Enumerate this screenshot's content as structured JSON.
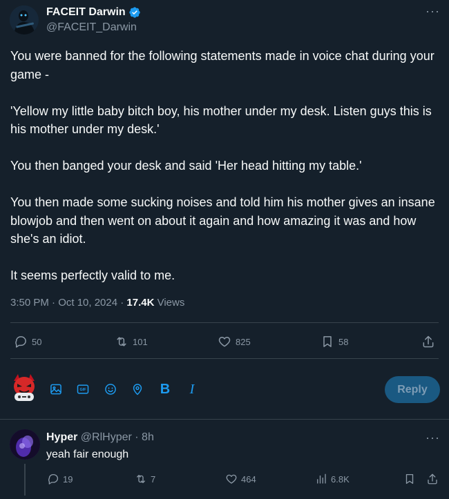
{
  "author": {
    "name": "FACEIT Darwin",
    "handle": "@FACEIT_Darwin"
  },
  "tweet": {
    "paragraphs": [
      "You were banned for the following statements made in voice chat during your game -",
      "'Yellow my little baby bitch boy, his mother under my desk. Listen guys this is his mother under my desk.'",
      "You then banged your desk and said 'Her head hitting my table.'",
      "You then made some sucking noises and told him his mother gives an insane blowjob and then went on about it again and how amazing it was and how she's an idiot.",
      "It seems perfectly valid to me."
    ],
    "timestamp": "3:50 PM · Oct 10, 2024 · ",
    "views_count": "17.4K",
    "views_label": " Views"
  },
  "actions": {
    "replies": "50",
    "reposts": "101",
    "likes": "825",
    "bookmarks": "58"
  },
  "compose": {
    "tools": {
      "bold": "B",
      "italic": "I"
    },
    "reply_label": "Reply"
  },
  "reply": {
    "name": "Hyper",
    "handle_time": " @RlHyper · 8h",
    "text": "yeah fair enough",
    "actions": {
      "replies": "19",
      "reposts": "7",
      "likes": "464",
      "views": "6.8K"
    }
  },
  "colors": {
    "background": "#15202b",
    "accent": "#1d9bf0",
    "muted": "#8b98a5",
    "divider": "#38444d",
    "reply_button": "#1a5982"
  }
}
